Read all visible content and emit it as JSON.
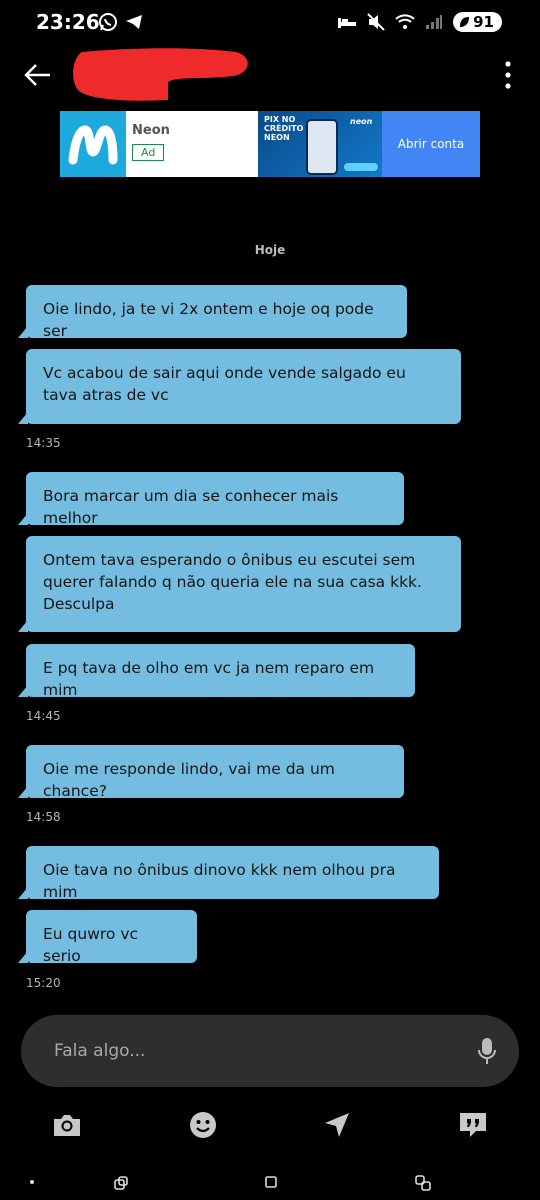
{
  "status_bar": {
    "time": "23:26",
    "battery": "91"
  },
  "ad": {
    "brand": "Neon",
    "badge": "Ad",
    "image_title": "PIX NO CRÉDITO NEON",
    "image_brand": "neon",
    "cta": "Abrir conta"
  },
  "chat": {
    "date": "Hoje",
    "messages": [
      {
        "text": "Oie lindo, ja te vi 2x ontem e hoje oq pode ser"
      },
      {
        "text": "Vc acabou de sair aqui onde vende salgado  eu tava atras de vc"
      },
      {
        "time": "14:35"
      },
      {
        "text": "Bora marcar um dia se conhecer mais melhor"
      },
      {
        "text": "Ontem tava esperando o ônibus eu escutei sem querer falando q não queria ele na sua casa kkk. Desculpa"
      },
      {
        "text": "E pq tava de olho em vc ja nem reparo em mim"
      },
      {
        "time": "14:45"
      },
      {
        "text": "Oie me responde lindo, vai me da um chance?"
      },
      {
        "time": "14:58"
      },
      {
        "text": "Oie tava no ônibus dinovo kkk nem olhou pra mim"
      },
      {
        "text": "Eu quwro vc serio"
      },
      {
        "time": "15:20"
      }
    ]
  },
  "composer": {
    "placeholder": "Fala algo..."
  },
  "icons": {
    "back": "arrow-left-icon",
    "menu": "more-vertical-icon",
    "mic": "microphone-icon",
    "camera": "camera-icon",
    "emoji": "smiley-icon",
    "send": "location-arrow-icon",
    "quote": "quote-bubble-icon"
  },
  "colors": {
    "bubble": "#74bde0",
    "background": "#000000",
    "composer": "#2e2e2e",
    "redaction": "#ef2a2a"
  }
}
